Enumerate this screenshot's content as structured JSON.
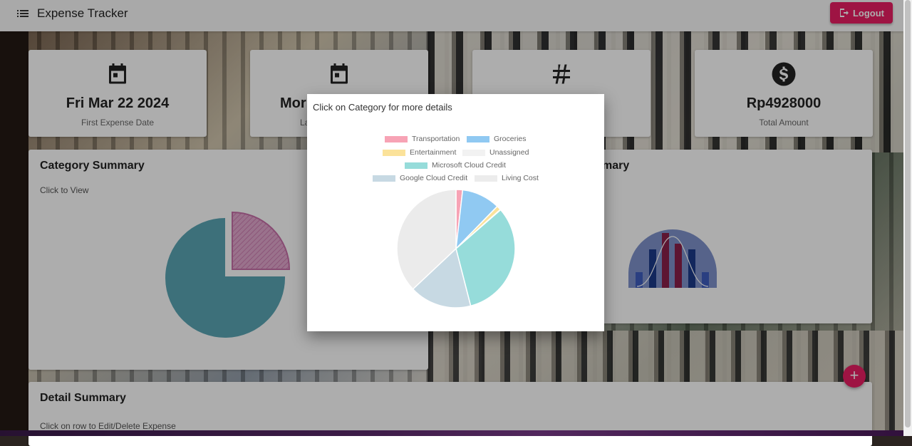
{
  "app": {
    "title": "Expense Tracker",
    "logout_label": "Logout"
  },
  "stats": [
    {
      "icon": "calendar-icon",
      "value": "Fri Mar 22 2024",
      "label": "First Expense Date"
    },
    {
      "icon": "calendar-icon",
      "value": "Mor",
      "label": "La"
    },
    {
      "icon": "hash-icon",
      "value": "",
      "label": ""
    },
    {
      "icon": "dollar-icon",
      "value": "Rp4928000",
      "label": "Total Amount"
    }
  ],
  "category_summary": {
    "title": "Category Summary",
    "subtitle": "Click to View"
  },
  "right_summary": {
    "title_partial": "mary"
  },
  "detail_summary": {
    "title": "Detail Summary",
    "subtitle": "Click on row to Edit/Delete Expense"
  },
  "dialog": {
    "title": "Click on Category for more details",
    "legend": [
      {
        "name": "Transportation",
        "color": "#f7a3b5"
      },
      {
        "name": "Groceries",
        "color": "#90c9f2"
      },
      {
        "name": "Entertainment",
        "color": "#fbe29a"
      },
      {
        "name": "Unassigned",
        "color": "#f2f2f2"
      },
      {
        "name": "Microsoft Cloud Credit",
        "color": "#96dcda"
      },
      {
        "name": "Google Cloud Credit",
        "color": "#c7d9e3"
      },
      {
        "name": "Living Cost",
        "color": "#ececec"
      }
    ]
  },
  "chart_data": {
    "type": "pie",
    "labels": [
      "Transportation",
      "Groceries",
      "Entertainment",
      "Unassigned",
      "Microsoft Cloud Credit",
      "Google Cloud Credit",
      "Living Cost"
    ],
    "values": [
      1.8,
      10.5,
      1.2,
      0.1,
      32.4,
      17.0,
      37.0
    ],
    "colors": [
      "#f7a3b5",
      "#90c9f2",
      "#fbe29a",
      "#f5f5f5",
      "#96dcda",
      "#c7d9e3",
      "#ebebeb"
    ]
  },
  "colors": {
    "accent": "#e91e63",
    "teal": "#5aa5b4",
    "pink_slice": "#d68fbd"
  }
}
